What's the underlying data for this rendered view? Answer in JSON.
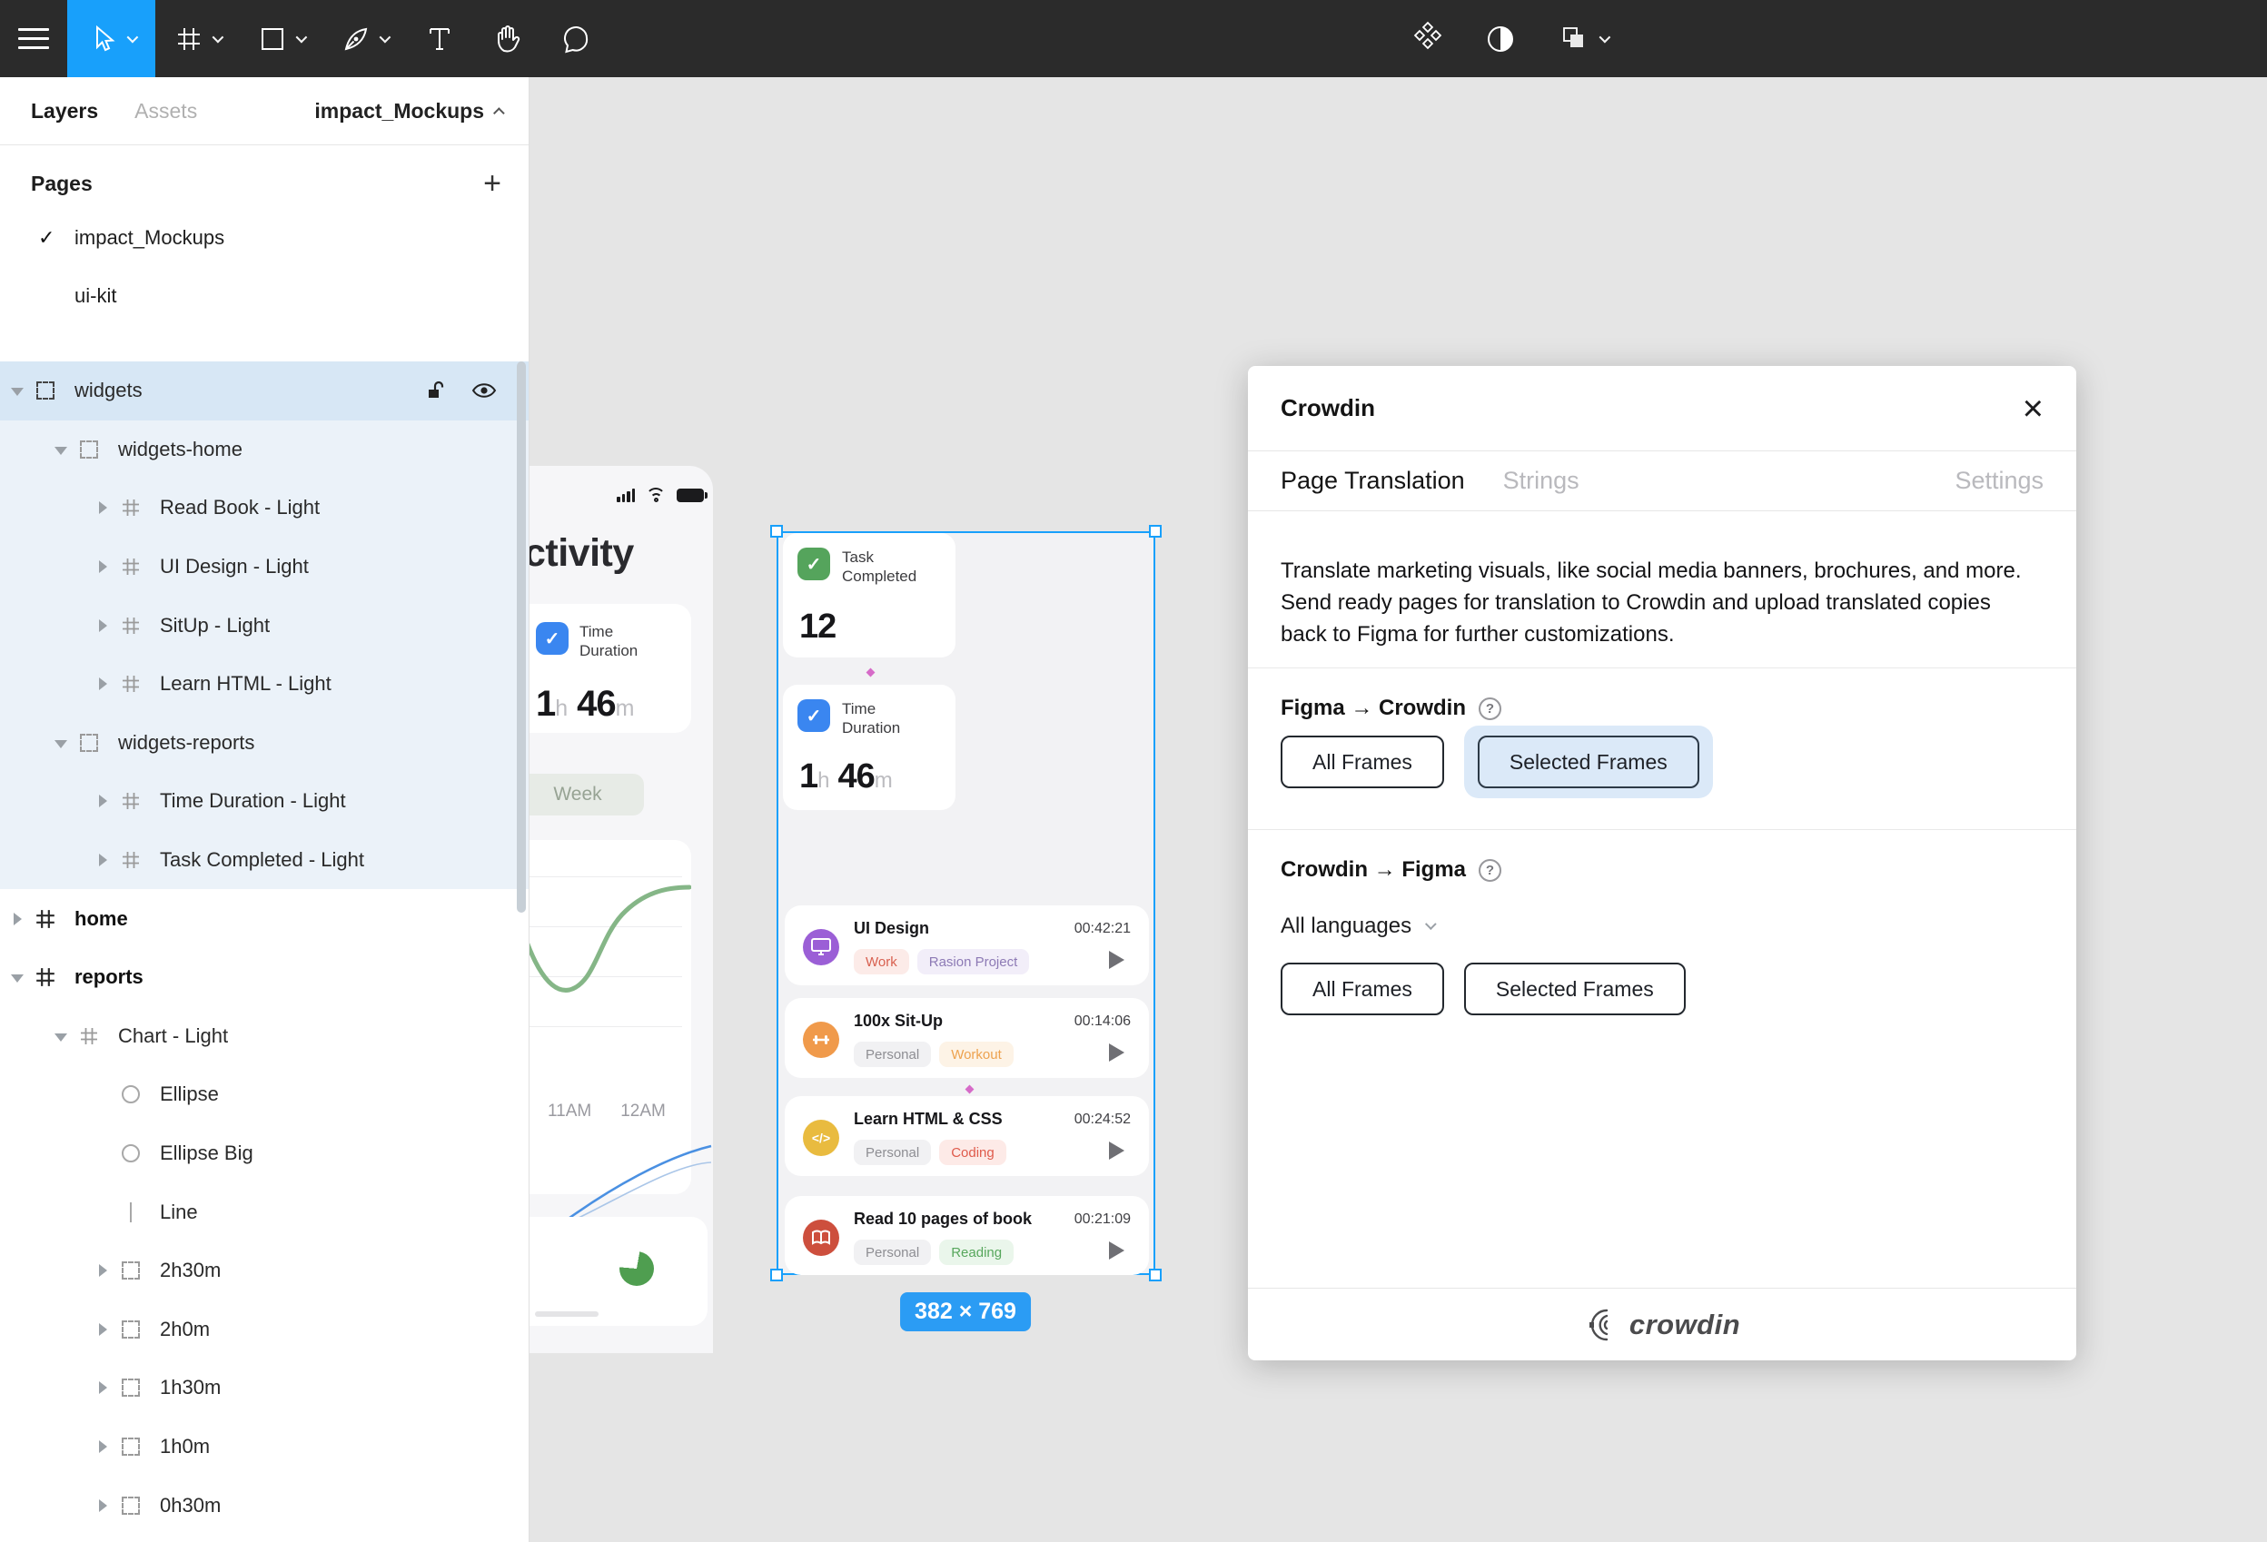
{
  "toolbar": {
    "tools": [
      "menu",
      "move-tool",
      "frame-tool",
      "shape-tool",
      "pen-tool",
      "text-tool",
      "hand-tool",
      "comment-tool"
    ],
    "right_tools": [
      "component-icon",
      "mask-icon",
      "boolean-group-icon"
    ]
  },
  "sidebar": {
    "tabs": {
      "layers": "Layers",
      "assets": "Assets",
      "file_name": "impact_Mockups"
    },
    "pages": {
      "title": "Pages",
      "items": [
        {
          "label": "impact_Mockups",
          "checked": true,
          "check_glyph": "✓"
        },
        {
          "label": "ui-kit",
          "checked": false
        }
      ]
    },
    "tree": [
      {
        "label": "widgets",
        "icon": "section-dashed-icon",
        "depth": 0,
        "selected": true
      },
      {
        "label": "widgets-home",
        "icon": "section-dashed-icon",
        "depth": 1
      },
      {
        "label": "Read Book - Light",
        "icon": "frame-grid-icon",
        "depth": 2
      },
      {
        "label": "UI Design - Light",
        "icon": "frame-grid-icon",
        "depth": 2
      },
      {
        "label": "SitUp - Light",
        "icon": "frame-grid-icon",
        "depth": 2
      },
      {
        "label": "Learn HTML - Light",
        "icon": "frame-grid-icon",
        "depth": 2
      },
      {
        "label": "widgets-reports",
        "icon": "section-dashed-icon",
        "depth": 1
      },
      {
        "label": "Time Duration - Light",
        "icon": "frame-grid-icon",
        "depth": 2
      },
      {
        "label": "Task Completed - Light",
        "icon": "frame-grid-icon",
        "depth": 2
      },
      {
        "label": "home",
        "icon": "frame-grid-icon",
        "depth": 0
      },
      {
        "label": "reports",
        "icon": "frame-grid-icon",
        "depth": 0
      },
      {
        "label": "Chart - Light",
        "icon": "frame-grid-icon",
        "depth": 1
      },
      {
        "label": "Ellipse",
        "icon": "ellipse-icon",
        "depth": 2
      },
      {
        "label": "Ellipse Big",
        "icon": "ellipse-icon",
        "depth": 2
      },
      {
        "label": "Line",
        "icon": "line-icon",
        "depth": 2
      },
      {
        "label": "2h30m",
        "icon": "section-dashed-icon",
        "depth": 2
      },
      {
        "label": "2h0m",
        "icon": "section-dashed-icon",
        "depth": 2
      },
      {
        "label": "1h30m",
        "icon": "section-dashed-icon",
        "depth": 2
      },
      {
        "label": "1h0m",
        "icon": "section-dashed-icon",
        "depth": 2
      },
      {
        "label": "0h30m",
        "icon": "section-dashed-icon",
        "depth": 2
      }
    ]
  },
  "canvas": {
    "partial_phone": {
      "title_visible": "ctivity",
      "week_pill": "Week",
      "x_labels": [
        "11AM",
        "12AM"
      ],
      "time_card": {
        "label_line1": "Time",
        "label_line2": "Duration",
        "hours": "1",
        "hours_unit": "h",
        "minutes": "46",
        "minutes_unit": "m",
        "check_color": "#3a86f0"
      }
    },
    "frame": {
      "size_label": "382 × 769",
      "stat_cards": [
        {
          "label_line1": "Task",
          "label_line2": "Completed",
          "value": "12",
          "check_color": "#55a45c"
        },
        {
          "label_line1": "Time",
          "label_line2": "Duration",
          "hours": "1",
          "hours_unit": "h",
          "minutes": "46",
          "minutes_unit": "m",
          "check_color": "#3a86f0"
        }
      ],
      "tasks": [
        {
          "title": "UI Design",
          "time": "00:42:21",
          "icon": "monitor-icon",
          "icon_color": "#9b5fd6",
          "tags": [
            {
              "label": "Work",
              "color": "#d8604f",
              "bg": "#fcebe8"
            },
            {
              "label": "Rasion Project",
              "color": "#8d7ab5",
              "bg": "#f2eef9"
            }
          ]
        },
        {
          "title": "100x Sit-Up",
          "time": "00:14:06",
          "icon": "dumbbell-icon",
          "icon_color": "#f09a4b",
          "tags": [
            {
              "label": "Personal",
              "color": "#8e8e93",
              "bg": "#f1f1f3"
            },
            {
              "label": "Workout",
              "color": "#eda24f",
              "bg": "#fdf3e6"
            }
          ]
        },
        {
          "title": "Learn HTML & CSS",
          "time": "00:24:52",
          "icon": "code-icon",
          "icon_color": "#e9bb3f",
          "tags": [
            {
              "label": "Personal",
              "color": "#8e8e93",
              "bg": "#f1f1f3"
            },
            {
              "label": "Coding",
              "color": "#df5a4b",
              "bg": "#fdeae7"
            }
          ]
        },
        {
          "title": "Read 10 pages of book",
          "time": "00:21:09",
          "icon": "book-icon",
          "icon_color": "#cd4f3d",
          "tags": [
            {
              "label": "Personal",
              "color": "#8e8e93",
              "bg": "#f1f1f3"
            },
            {
              "label": "Reading",
              "color": "#57a75c",
              "bg": "#eaf6eb"
            }
          ]
        }
      ]
    }
  },
  "modal": {
    "title": "Crowdin",
    "tabs": [
      {
        "label": "Page Translation",
        "active": true
      },
      {
        "label": "Strings",
        "active": false
      },
      {
        "label": "Settings",
        "active": false
      }
    ],
    "description": "Translate marketing visuals, like social media banners, brochures, and more. Send ready pages for translation to Crowdin and upload translated copies back to Figma for further customizations.",
    "figma_to_crowdin": {
      "heading": "Figma → Crowdin",
      "help_glyph": "?",
      "all_frames": "All Frames",
      "selected_frames": "Selected Frames",
      "selected_option": "Selected Frames"
    },
    "crowdin_to_figma": {
      "heading": "Crowdin → Figma",
      "help_glyph": "?",
      "language_selector": "All languages",
      "all_frames": "All Frames",
      "selected_frames": "Selected Frames"
    },
    "footer_logo_text": "crowdin"
  },
  "colors": {
    "accent_blue": "#18a0fb",
    "size_badge_blue": "#2b9cf4",
    "selection_halo": "#dbe9f8",
    "toolbar_bg": "#2b2b2b",
    "canvas_bg": "#e5e5e5",
    "selected_row": "#d7e7f5",
    "selected_subtree": "#ebf2f9"
  }
}
